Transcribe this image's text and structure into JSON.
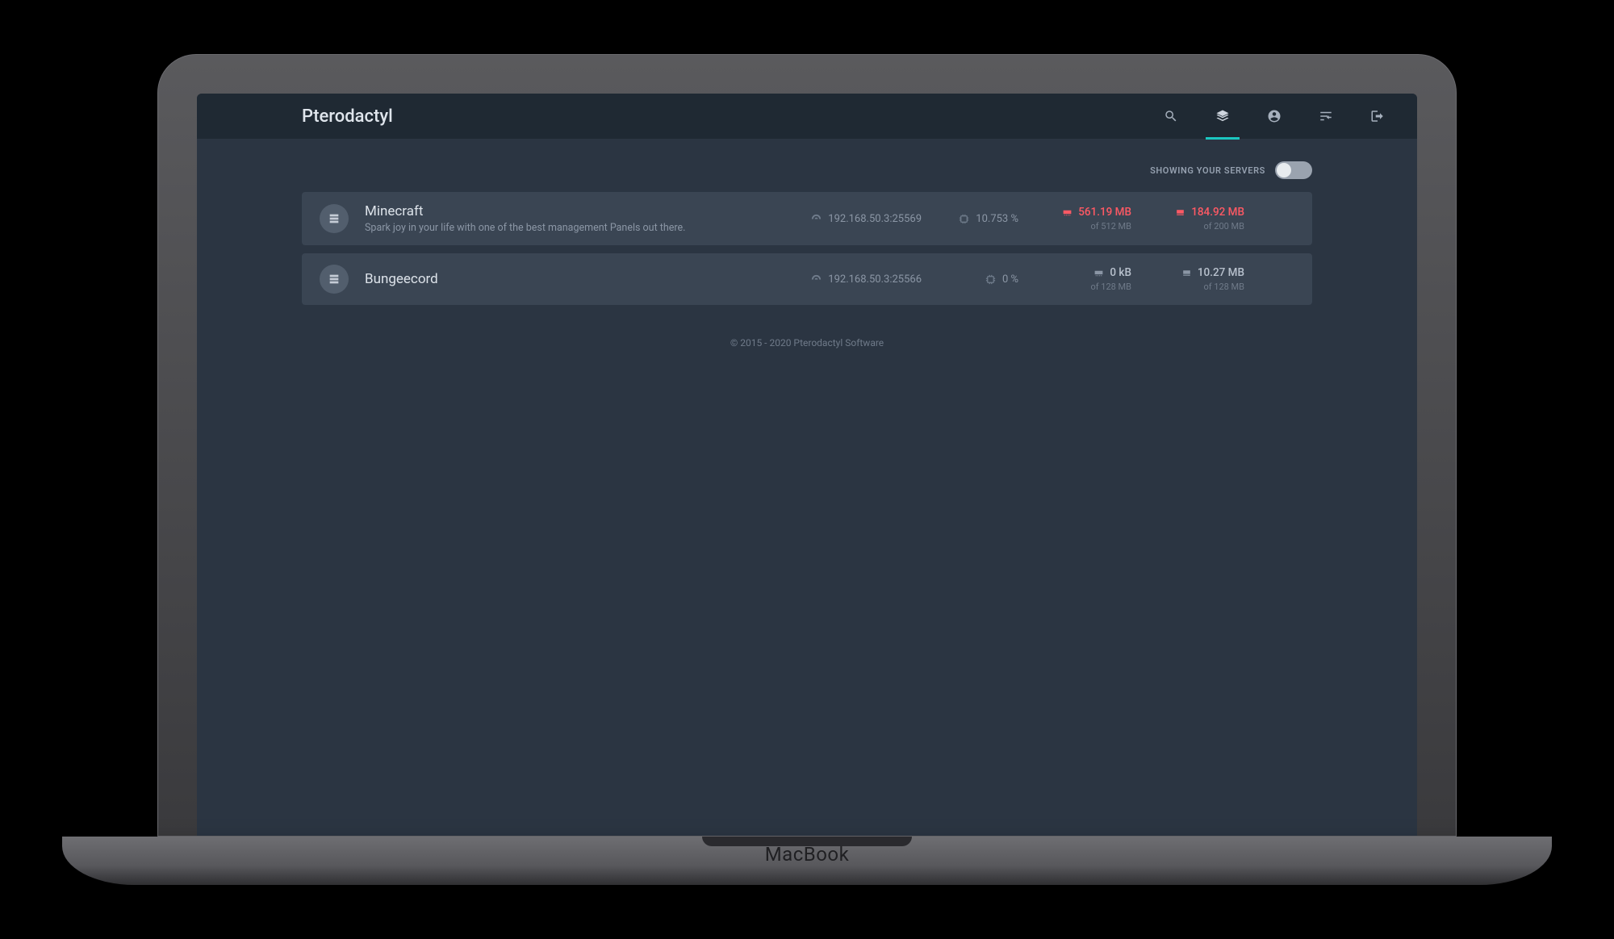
{
  "brand": "Pterodactyl",
  "toggle_label": "SHOWING YOUR SERVERS",
  "servers": [
    {
      "name": "Minecraft",
      "desc": "Spark joy in your life with one of the best management Panels out there.",
      "ip": "192.168.50.3:25569",
      "cpu": "10.753 %",
      "mem_val": "561.19 MB",
      "mem_of": "of 512 MB",
      "disk_val": "184.92 MB",
      "disk_of": "of 200 MB",
      "mem_alarm": true,
      "disk_alarm": true
    },
    {
      "name": "Bungeecord",
      "desc": "",
      "ip": "192.168.50.3:25566",
      "cpu": "0 %",
      "mem_val": "0 kB",
      "mem_of": "of 128 MB",
      "disk_val": "10.27 MB",
      "disk_of": "of 128 MB",
      "mem_alarm": false,
      "disk_alarm": false
    }
  ],
  "footer": "© 2015 - 2020 Pterodactyl Software",
  "laptop_logo": "MacBook"
}
